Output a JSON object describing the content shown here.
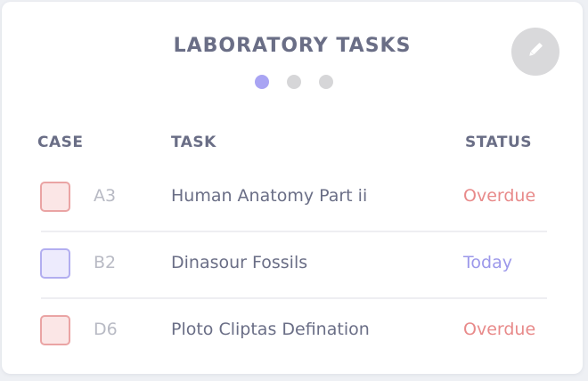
{
  "header": {
    "title": "LABORATORY TASKS"
  },
  "pager": {
    "total": 3,
    "active_index": 0
  },
  "columns": {
    "case": "CASE",
    "task": "TASK",
    "status": "STATUS"
  },
  "rows": [
    {
      "case": "A3",
      "task": "Human Anatomy Part ii",
      "status": "Overdue",
      "status_color": "#e88a8a",
      "checkbox_color": "red"
    },
    {
      "case": "B2",
      "task": "Dinasour Fossils",
      "status": "Today",
      "status_color": "#9c98ea",
      "checkbox_color": "blue"
    },
    {
      "case": "D6",
      "task": "Ploto Cliptas Defination",
      "status": "Overdue",
      "status_color": "#e88a8a",
      "checkbox_color": "red"
    }
  ],
  "icons": {
    "edit": "pencil-icon"
  },
  "colors": {
    "accent": "#a9a4f3",
    "overdue": "#e88a8a",
    "today": "#9c98ea",
    "heading": "#6a6e86"
  }
}
